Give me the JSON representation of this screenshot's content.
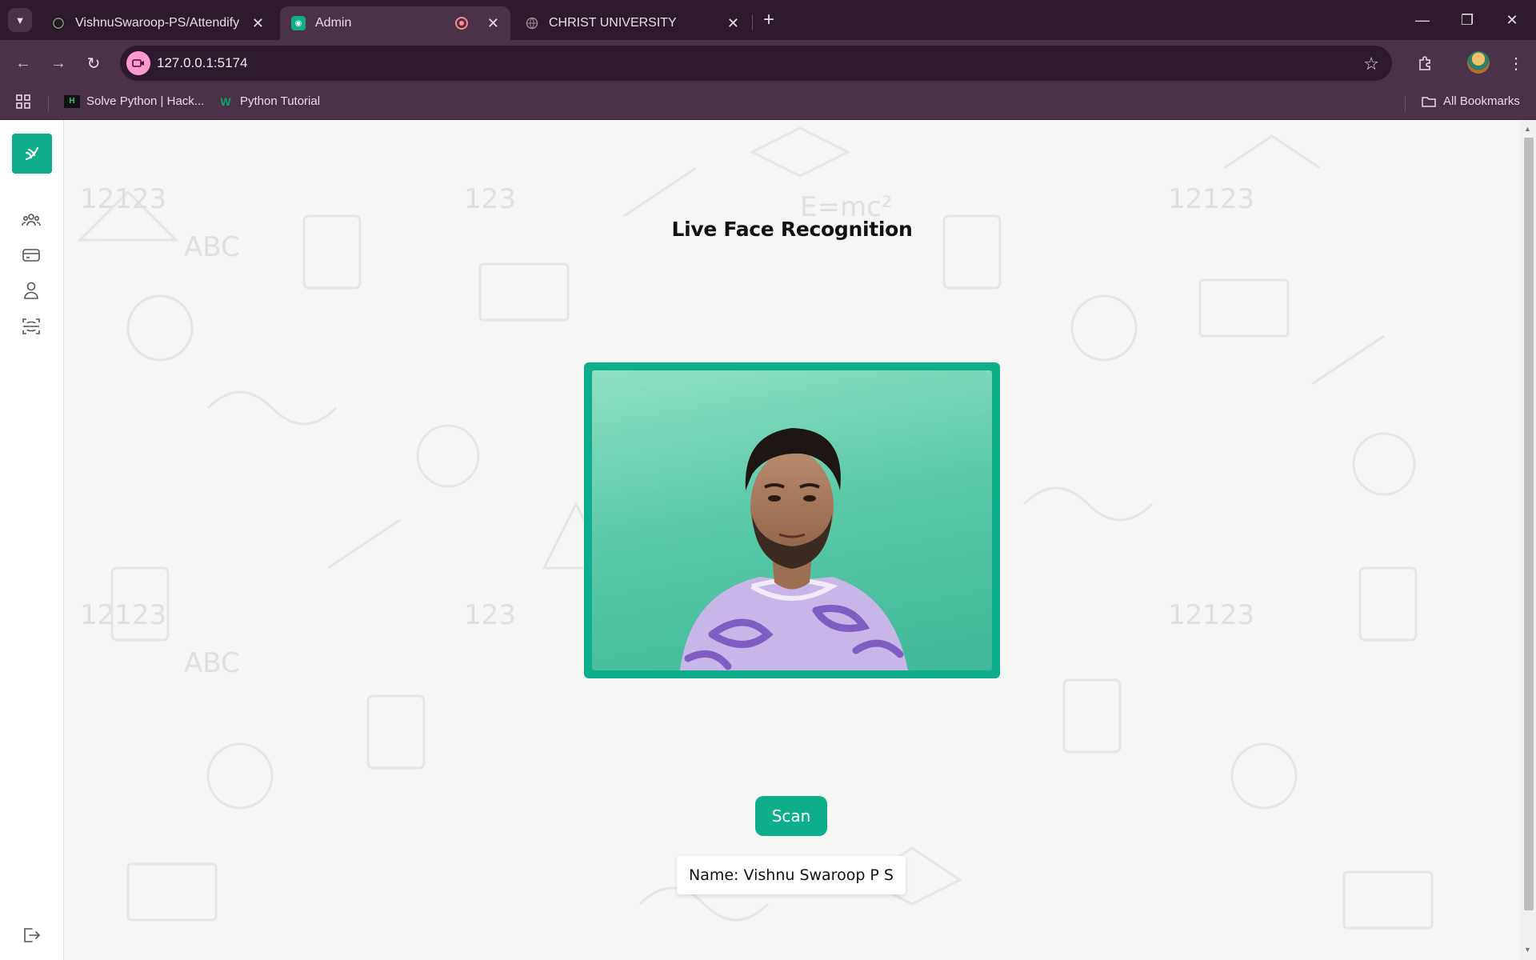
{
  "browser": {
    "tabs": [
      {
        "title": "VishnuSwaroop-PS/Attendify",
        "icon": "github-icon",
        "active": false
      },
      {
        "title": "Admin",
        "icon": "app-favicon-icon",
        "active": true,
        "recording": true
      },
      {
        "title": "CHRIST UNIVERSITY",
        "icon": "globe-icon",
        "active": false
      }
    ],
    "url": "127.0.0.1:5174",
    "bookmarks": [
      {
        "label": "Solve Python | Hack...",
        "icon": "hackerrank-icon"
      },
      {
        "label": "Python Tutorial",
        "icon": "w3schools-icon"
      }
    ],
    "all_bookmarks_label": "All Bookmarks"
  },
  "sidebar": {
    "items": [
      {
        "name": "students",
        "icon": "users-group-icon"
      },
      {
        "name": "cards",
        "icon": "id-card-icon"
      },
      {
        "name": "profile",
        "icon": "user-icon"
      },
      {
        "name": "scanner",
        "icon": "face-scan-icon"
      }
    ],
    "logout_icon": "logout-icon"
  },
  "main": {
    "title": "Live Face Recognition",
    "scan_label": "Scan",
    "result_prefix": "Name:",
    "result_name": "Vishnu Swaroop P S"
  },
  "colors": {
    "accent": "#0fae8a",
    "chrome_dark": "#2d1a2c",
    "chrome_mid": "#4a3248",
    "page_bg": "#f6f6f5"
  }
}
